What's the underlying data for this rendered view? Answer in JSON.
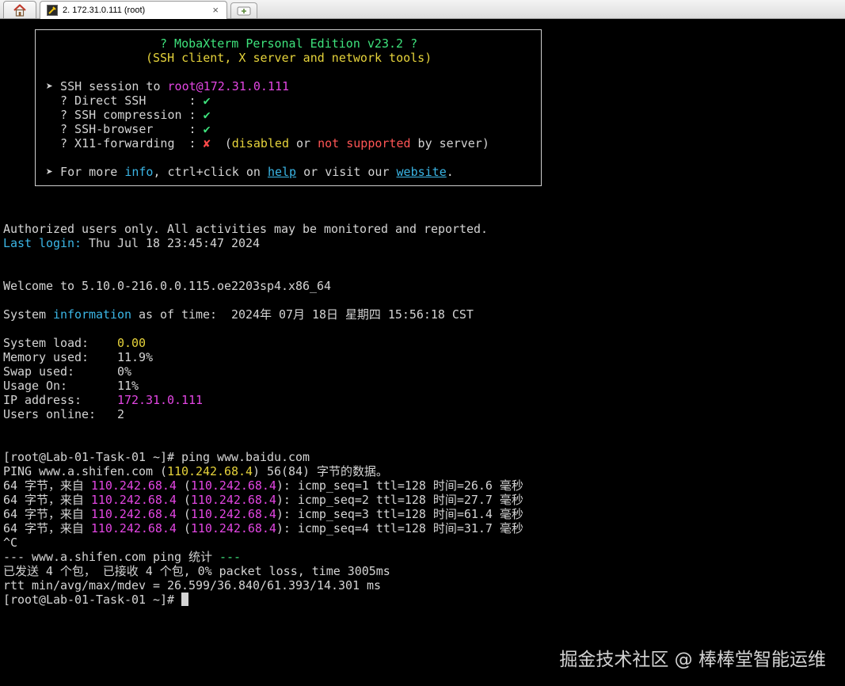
{
  "tabs": {
    "home_icon": "home-icon",
    "session_label": "2. 172.31.0.111 (root)",
    "close_glyph": "×",
    "new_tab_icon": "plus-icon"
  },
  "banner": {
    "title": "? MobaXterm Personal Edition v23.2 ?",
    "subtitle": "(SSH client, X server and network tools)",
    "session_prefix": "➤ SSH session to ",
    "session_target": "root@172.31.0.111",
    "rows": [
      {
        "label": "? Direct SSH      :",
        "mark": "✔"
      },
      {
        "label": "? SSH compression :",
        "mark": "✔"
      },
      {
        "label": "? SSH-browser     :",
        "mark": "✔"
      }
    ],
    "x11_label": "? X11-forwarding  :",
    "x11_mark": "✘",
    "x11_open": "(",
    "x11_disabled": "disabled",
    "x11_or": " or ",
    "x11_not_supported": "not supported",
    "x11_by": " by server)",
    "more_prefix": "➤ For more ",
    "more_info": "info",
    "more_mid": ", ctrl+click on ",
    "more_help": "help",
    "more_mid2": " or visit our ",
    "more_website": "website",
    "more_end": "."
  },
  "login": {
    "authorized": "Authorized users only. All activities may be monitored and reported.",
    "last_login_label": "Last login:",
    "last_login_value": " Thu Jul 18 23:45:47 2024",
    "welcome": "Welcome to 5.10.0-216.0.0.115.oe2203sp4.x86_64",
    "sysinfo_prefix": "System ",
    "sysinfo_word": "information",
    "sysinfo_rest": " as of time:  2024年 07月 18日 星期四 15:56:18 CST"
  },
  "stats": {
    "load_label": "System load:    ",
    "load_value": "0.00",
    "mem_label": "Memory used:    ",
    "mem_value": "11.9%",
    "swap_label": "Swap used:      ",
    "swap_value": "0%",
    "usage_label": "Usage On:       ",
    "usage_value": "11%",
    "ip_label": "IP address:     ",
    "ip_value": "172.31.0.111",
    "users_label": "Users online:   ",
    "users_value": "2"
  },
  "ping": {
    "prompt": "[root@Lab-01-Task-01 ~]# ",
    "command": "ping www.baidu.com",
    "header_a": "PING www.a.shifen.com (",
    "header_ip": "110.242.68.4",
    "header_b": ") 56(84) 字节的数据。",
    "reply_a": "64 字节，来自 ",
    "reply_ip": "110.242.68.4",
    "reply_open": " (",
    "reply_close": "): ",
    "replies": [
      "icmp_seq=1 ttl=128 时间=26.6 毫秒",
      "icmp_seq=2 ttl=128 时间=27.7 毫秒",
      "icmp_seq=3 ttl=128 时间=61.4 毫秒",
      "icmp_seq=4 ttl=128 时间=31.7 毫秒"
    ],
    "interrupt": "^C",
    "stats_a": "--- www.a.shifen.com ping ",
    "stats_word": "统计",
    "stats_b": " ---",
    "summary": "已发送 4 个包， 已接收 4 个包, 0% packet loss, time 3005ms",
    "rtt": "rtt min/avg/max/mdev = 26.599/36.840/61.393/14.301 ms",
    "final_prompt": "[root@Lab-01-Task-01 ~]# "
  },
  "watermark": "掘金技术社区 @ 棒棒堂智能运维",
  "colors": {
    "green": "#3ee27c",
    "yellow": "#e6d33b",
    "magenta": "#e346e3",
    "cyan": "#3bb6e6",
    "red": "#ff5555"
  }
}
